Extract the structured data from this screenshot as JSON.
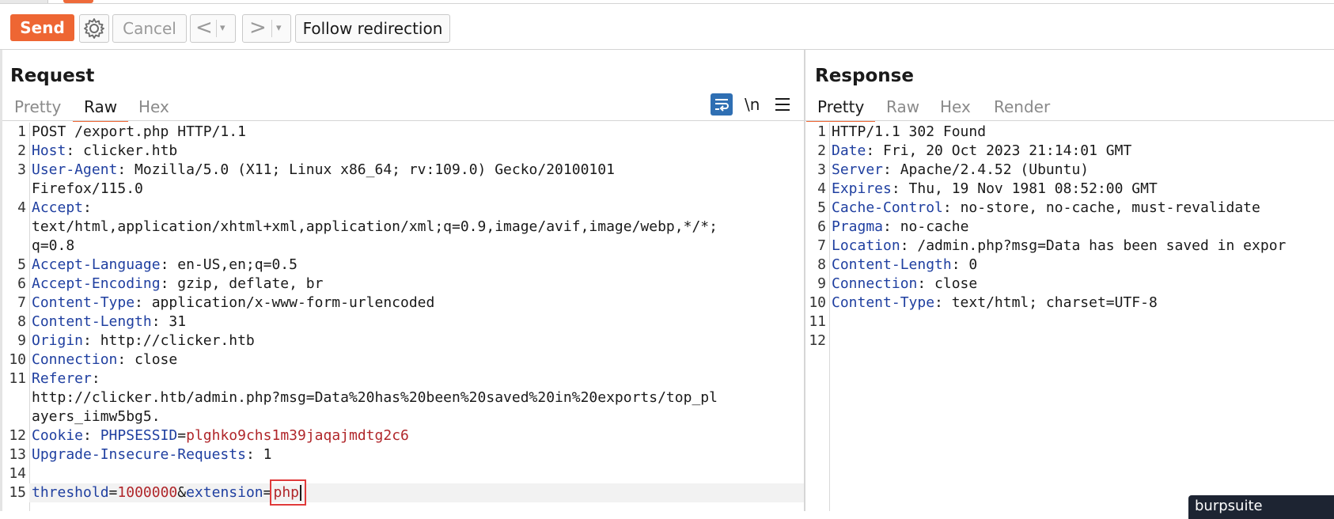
{
  "toolbar": {
    "send_label": "Send",
    "cancel_label": "Cancel",
    "back_glyph": "<",
    "forward_glyph": ">",
    "dropdown_glyph": "▾",
    "follow_label": "Follow redirection"
  },
  "request": {
    "title": "Request",
    "tabs": [
      "Pretty",
      "Raw",
      "Hex"
    ],
    "active_tab": "Raw",
    "newline_tool": "\\n",
    "lines": [
      {
        "n": "1",
        "rows": [
          {
            "plain": "POST /export.php HTTP/1.1"
          }
        ]
      },
      {
        "n": "2",
        "key": "Host",
        "value": "clicker.htb"
      },
      {
        "n": "3",
        "key": "User-Agent",
        "value": "Mozilla/5.0 (X11; Linux x86_64; rv:109.0) Gecko/20100101",
        "cont": [
          "Firefox/115.0"
        ]
      },
      {
        "n": "4",
        "key": "Accept",
        "value": "",
        "cont": [
          "text/html,application/xhtml+xml,application/xml;q=0.9,image/avif,image/webp,*/*;",
          "q=0.8"
        ]
      },
      {
        "n": "5",
        "key": "Accept-Language",
        "value": "en-US,en;q=0.5"
      },
      {
        "n": "6",
        "key": "Accept-Encoding",
        "value": "gzip, deflate, br"
      },
      {
        "n": "7",
        "key": "Content-Type",
        "value": "application/x-www-form-urlencoded"
      },
      {
        "n": "8",
        "key": "Content-Length",
        "value": "31"
      },
      {
        "n": "9",
        "key": "Origin",
        "value": "http://clicker.htb"
      },
      {
        "n": "10",
        "key": "Connection",
        "value": "close"
      },
      {
        "n": "11",
        "key": "Referer",
        "value": "",
        "cont": [
          "http://clicker.htb/admin.php?msg=Data%20has%20been%20saved%20in%20exports/top_pl",
          "ayers_iimw5bg5."
        ]
      },
      {
        "n": "12",
        "key": "Cookie",
        "cookie_name": "PHPSESSID",
        "cookie_value": "plghko9chs1m39jaqajmdtg2c6"
      },
      {
        "n": "13",
        "key": "Upgrade-Insecure-Requests",
        "value": "1"
      },
      {
        "n": "14",
        "blank": true
      },
      {
        "n": "15",
        "body": [
          {
            "k": "threshold",
            "v": "1000000"
          },
          {
            "k": "extension",
            "v": "php"
          }
        ]
      }
    ]
  },
  "response": {
    "title": "Response",
    "tabs": [
      "Pretty",
      "Raw",
      "Hex",
      "Render"
    ],
    "active_tab": "Pretty",
    "status_line": "HTTP/1.1 302 Found",
    "headers": [
      {
        "key": "Date",
        "value": "Fri, 20 Oct 2023 21:14:01 GMT"
      },
      {
        "key": "Server",
        "value": "Apache/2.4.52 (Ubuntu)"
      },
      {
        "key": "Expires",
        "value": "Thu, 19 Nov 1981 08:52:00 GMT"
      },
      {
        "key": "Cache-Control",
        "value": "no-store, no-cache, must-revalidate"
      },
      {
        "key": "Pragma",
        "value": "no-cache"
      },
      {
        "key": "Location",
        "value": "/admin.php?msg=Data has been saved in expor"
      },
      {
        "key": "Content-Length",
        "value": "0"
      },
      {
        "key": "Connection",
        "value": "close"
      },
      {
        "key": "Content-Type",
        "value": "text/html; charset=UTF-8"
      }
    ],
    "line_numbers": [
      "1",
      "2",
      "3",
      "4",
      "5",
      "6",
      "7",
      "8",
      "9",
      "10",
      "11",
      "12"
    ]
  },
  "tooltip_text": "burpsuite",
  "colors": {
    "accent": "#ee6633",
    "header_key": "#1f3fa0",
    "param_value": "#b0262a",
    "highlight_box": "#e03b3b"
  }
}
